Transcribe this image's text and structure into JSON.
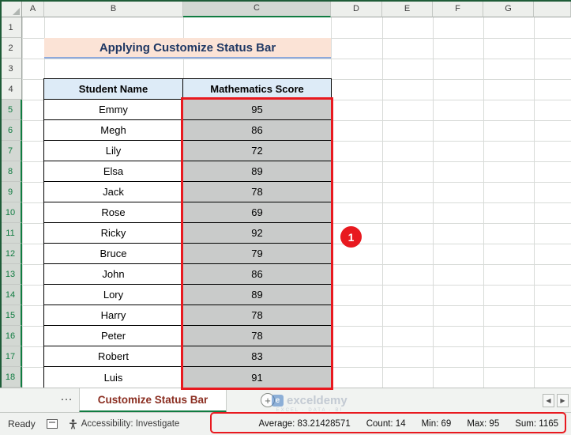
{
  "sheet": {
    "column_letters": [
      "A",
      "B",
      "C",
      "D",
      "E",
      "F",
      "G"
    ],
    "row_count": 18,
    "selection": {
      "column": "C",
      "row_start": 5,
      "row_end": 18
    }
  },
  "title": {
    "text": "Applying Customize Status Bar"
  },
  "table": {
    "headers": [
      "Student Name",
      "Mathematics Score"
    ],
    "rows": [
      {
        "name": "Emmy",
        "score": "95"
      },
      {
        "name": "Megh",
        "score": "86"
      },
      {
        "name": "Lily",
        "score": "72"
      },
      {
        "name": "Elsa",
        "score": "89"
      },
      {
        "name": "Jack",
        "score": "78"
      },
      {
        "name": "Rose",
        "score": "69"
      },
      {
        "name": "Ricky",
        "score": "92"
      },
      {
        "name": "Bruce",
        "score": "79"
      },
      {
        "name": "John",
        "score": "86"
      },
      {
        "name": "Lory",
        "score": "89"
      },
      {
        "name": "Harry",
        "score": "78"
      },
      {
        "name": "Peter",
        "score": "78"
      },
      {
        "name": "Robert",
        "score": "83"
      },
      {
        "name": "Luis",
        "score": "91"
      }
    ]
  },
  "annotations": {
    "badge_label": "1"
  },
  "tabs": {
    "overflow": "…",
    "active": "Customize Status Bar",
    "new_sheet": "+",
    "scroll_left": "◀",
    "scroll_right": "▶"
  },
  "status_bar": {
    "mode": "Ready",
    "accessibility": "Accessibility: Investigate",
    "stats": [
      "Average: 83.21428571",
      "Count: 14",
      "Min: 69",
      "Max: 95",
      "Sum: 1165"
    ]
  },
  "watermark": {
    "logo_glyph": "e",
    "brand": "exceldemy",
    "tagline": "EXCEL · DATA · BI"
  },
  "colors": {
    "accent_green": "#107C41",
    "annotation_red": "#E8191F",
    "title_bg": "#FBE3D6",
    "title_text": "#1F3864",
    "table_header_bg": "#DDEBF7",
    "sel_fill": "#C9CBCA",
    "tab_text": "#8B2E21",
    "wm_blue": "#3C78C3"
  }
}
